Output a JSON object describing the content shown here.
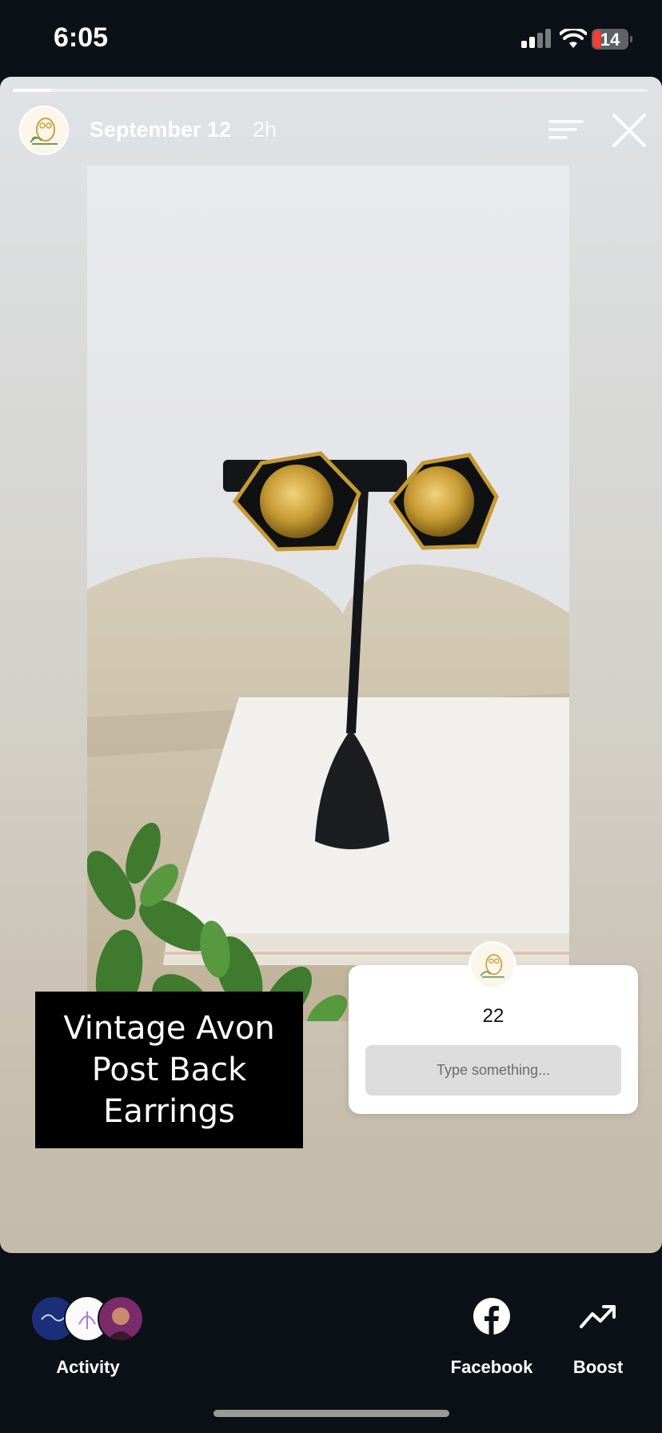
{
  "status_bar": {
    "time": "6:05",
    "battery": "14"
  },
  "story": {
    "progress_fraction": 0.06,
    "date": "September 12",
    "ago": "2h",
    "sticker_lines": [
      "Vintage Avon",
      "Post Back",
      "Earrings"
    ],
    "question": {
      "count": "22",
      "placeholder": "Type something..."
    }
  },
  "bottom_bar": {
    "activity_label": "Activity",
    "facebook_label": "Facebook",
    "boost_label": "Boost"
  },
  "colors": {
    "background": "#0c1117",
    "battery_low": "#ff3b30",
    "accent_gold": "#c9a23c"
  },
  "icons": [
    "signal-icon",
    "wifi-icon",
    "battery-icon",
    "menu-icon",
    "close-icon",
    "facebook-icon",
    "boost-icon"
  ]
}
